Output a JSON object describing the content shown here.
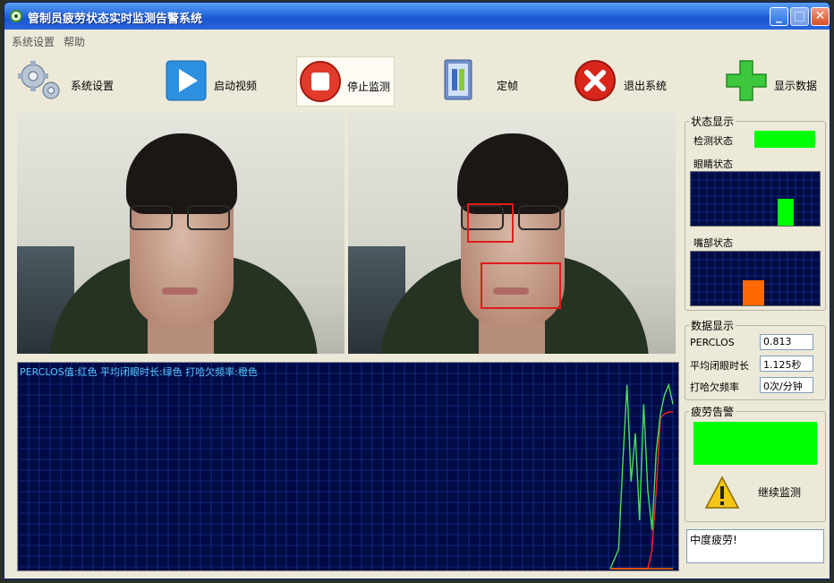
{
  "window": {
    "title": "管制员疲劳状态实时监测告警系统",
    "minimize": "_",
    "maximize": "□",
    "close": "✕"
  },
  "menu": [
    "系统设置",
    "帮助"
  ],
  "toolbar": {
    "settings": "系统设置",
    "start_video": "启动视频",
    "stop_monitor": "停止监测",
    "freeze_frame": "定帧",
    "exit": "退出系统",
    "show_data": "显示数据"
  },
  "chart": {
    "legend": "PERCLOS值:红色 平均闭眼时长:绿色 打哈欠频率:橙色"
  },
  "status": {
    "group_title": "状态显示",
    "detect_label": "检测状态",
    "eye_label": "眼睛状态",
    "mouth_label": "嘴部状态"
  },
  "data": {
    "group_title": "数据显示",
    "perclos_label": "PERCLOS",
    "perclos_value": "0.813",
    "closure_label": "平均闭眼时长",
    "closure_value": "1.125秒",
    "yawn_label": "打哈欠频率",
    "yawn_value": "0次/分钟"
  },
  "alarm": {
    "group_title": "疲劳告警",
    "continue_label": "继续监测",
    "message": "中度疲劳!"
  },
  "colors": {
    "grid_bg": "#000a44",
    "grid_line": "#1f3fa8",
    "ok_green": "#00ff00",
    "perclos_red": "#ff2020",
    "closure_green": "#49e05a",
    "yawn_orange": "#ff6a00"
  },
  "chart_data": {
    "type": "line",
    "title": "",
    "series": [
      {
        "name": "PERCLOS",
        "color": "#ff2020",
        "values": [
          0,
          0,
          0,
          0,
          0,
          0,
          0,
          0,
          0,
          0,
          0.1,
          0.4,
          0.78,
          0.8,
          0.81,
          0.81
        ]
      },
      {
        "name": "平均闭眼时长",
        "color": "#49e05a",
        "values": [
          0,
          0.05,
          0.1,
          0.55,
          0.95,
          0.45,
          0.7,
          0.25,
          0.85,
          0.4,
          0.2,
          0.6,
          0.8,
          0.9,
          0.95,
          0.85
        ]
      },
      {
        "name": "打哈欠频率",
        "color": "#ff6a00",
        "values": [
          0,
          0,
          0,
          0,
          0,
          0,
          0,
          0,
          0,
          0,
          0,
          0,
          0,
          0,
          0,
          0
        ]
      }
    ],
    "ylim": [
      0,
      1
    ],
    "grid": true
  }
}
